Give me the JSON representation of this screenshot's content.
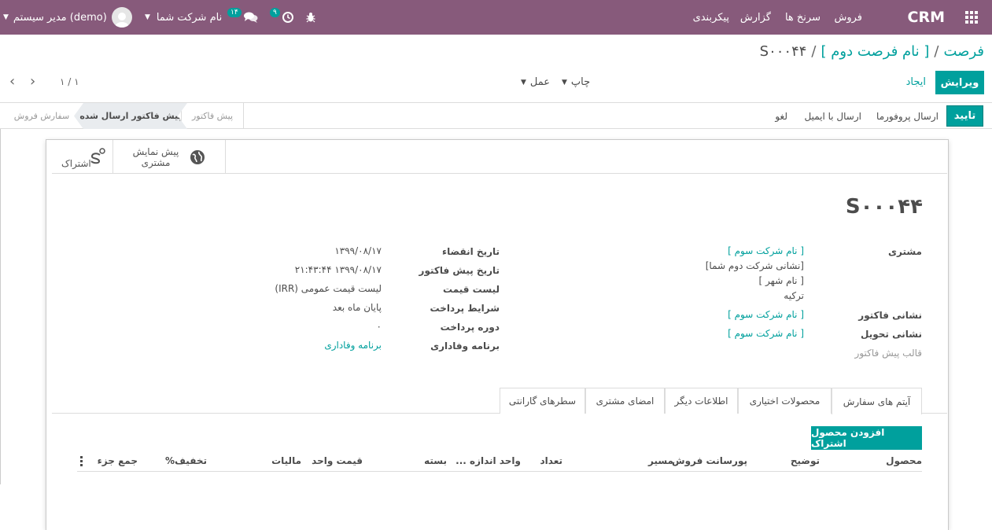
{
  "navbar": {
    "brand": "CRM",
    "menu": [
      "فروش",
      "سرنخ ها",
      "گزارش",
      "پیکربندی"
    ],
    "messages_badge": "۱۴",
    "activities_badge": "۹",
    "company": "نام شرکت شما",
    "user": "مدیر سیستم (demo)"
  },
  "breadcrumb": {
    "root": "فرصت",
    "opportunity": "[ نام فرصت دوم ]",
    "current": "S۰۰۰۴۴"
  },
  "control": {
    "edit": "ویرایش",
    "create": "ایجاد",
    "print": "چاپ",
    "action": "عمل",
    "pager": "۱ / ۱"
  },
  "statusbar": {
    "confirm": "تایید",
    "send_proforma": "ارسال پروفورما",
    "send_email": "ارسال با ایمیل",
    "cancel": "لغو",
    "stages": [
      "پیش فاکتور",
      "پیش فاکتور ارسال شده",
      "سفارش فروش"
    ]
  },
  "smart_buttons": {
    "preview_line1": "پیش نمایش",
    "preview_line2": "مشتری",
    "subscription": "اشتراک"
  },
  "form": {
    "name": "S۰۰۰۴۴",
    "customer_label": "مشتری",
    "customer_name": "[ نام شرکت سوم ]",
    "customer_addr1": "[نشانی شرکت دوم شما]",
    "customer_city": "[ نام شهر ]",
    "customer_country": "ترکیه",
    "invoice_addr_label": "نشانی فاکتور",
    "invoice_addr": "[ نام شرکت سوم ]",
    "delivery_addr_label": "نشانی تحویل",
    "delivery_addr": "[ نام شرکت سوم ]",
    "template_label": "قالب پیش فاکتور",
    "expiry_label": "تاریخ انقضاء",
    "expiry": "۱۳۹۹/۰۸/۱۷",
    "quote_date_label": "تاریخ پیش فاکتور",
    "quote_date": "۱۳۹۹/۰۸/۱۷ ۲۱:۴۳:۴۴",
    "pricelist_label": "لیست قیمت",
    "pricelist": "لیست قیمت عمومی (IRR)",
    "payment_terms_label": "شرایط پرداخت",
    "payment_terms": "پایان ماه بعد",
    "payment_period_label": "دوره پرداخت",
    "payment_period": "۰",
    "loyalty_label": "برنامه وفاداری",
    "loyalty": "برنامه وفاداری"
  },
  "tabs": [
    "آیتم های سفارش",
    "محصولات اختیاری",
    "اطلاعات دیگر",
    "امضای مشتری",
    "سطرهای گارانتی"
  ],
  "order_lines": {
    "add_subscription": "افزودن محصول اشتراک",
    "columns": [
      "محصول",
      "توضیح",
      "پورسانت فروش",
      "مسیر",
      "تعداد",
      "واحد اندازه ...",
      "بسته",
      "قیمت واحد",
      "مالیات",
      "تخفیف%",
      "جمع جزء"
    ]
  },
  "colors": {
    "navbar": "#875a7b",
    "primary": "#00a09d"
  }
}
